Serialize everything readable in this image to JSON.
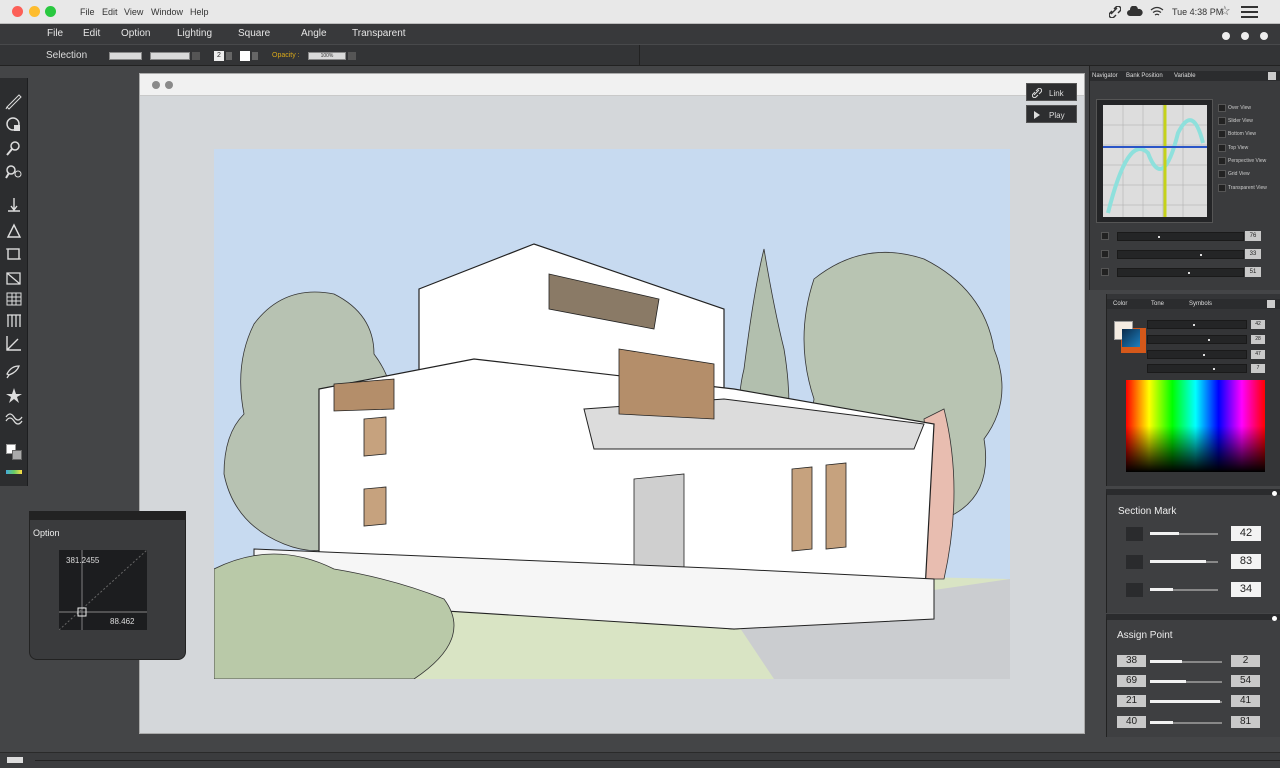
{
  "mac_menu": {
    "items": [
      "File",
      "Edit",
      "View",
      "Window",
      "Help"
    ],
    "clock": "Tue 4:38 PM"
  },
  "app_menu": {
    "items": [
      "File",
      "Edit",
      "Option",
      "Lighting",
      "Square",
      "Angle",
      "Transparent"
    ]
  },
  "options_bar": {
    "label": "Selection",
    "stepper_value": "2",
    "opacity_label": "Opacity :",
    "opacity_value": "100%"
  },
  "doc_actions": {
    "link_label": "Link",
    "play_label": "Play"
  },
  "option_panel": {
    "title": "Option",
    "top_value": "381.2455",
    "bottom_value": "88.462"
  },
  "navigator": {
    "tabs": [
      "Navigator",
      "Bank Position",
      "Variable"
    ],
    "views": [
      "Over View",
      "Slider View",
      "Bottom View",
      "Top View",
      "Perspective View",
      "Grid View",
      "Transparent View"
    ],
    "sliders": [
      {
        "value": "76"
      },
      {
        "value": "33"
      },
      {
        "value": "51"
      }
    ]
  },
  "color_panel": {
    "tabs": [
      "Color",
      "Tone",
      "Symbols"
    ],
    "sliders": [
      {
        "value": "42"
      },
      {
        "value": "28"
      },
      {
        "value": "47"
      },
      {
        "value": "7"
      }
    ],
    "foreground": "#f4ece2",
    "background": "#d4581a"
  },
  "section_mark": {
    "title": "Section Mark",
    "rows": [
      {
        "value": "42",
        "level": 0.42
      },
      {
        "value": "83",
        "level": 0.83
      },
      {
        "value": "34",
        "level": 0.34
      }
    ]
  },
  "assign_point": {
    "title": "Assign Point",
    "rows": [
      {
        "left": "38",
        "right": "2",
        "level": 0.45
      },
      {
        "left": "69",
        "right": "54",
        "level": 0.5
      },
      {
        "left": "21",
        "right": "41",
        "level": 0.97
      },
      {
        "left": "40",
        "right": "81",
        "level": 0.32
      }
    ]
  }
}
